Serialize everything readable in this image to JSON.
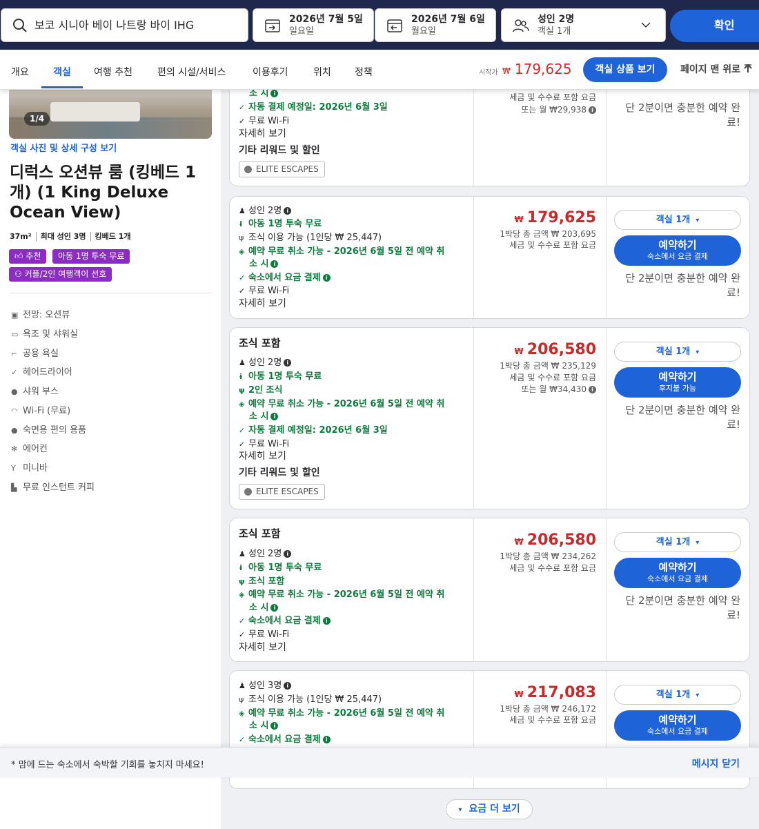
{
  "search": {
    "destination": "보코 시니아 베이 나트랑 바이 IHG",
    "checkin_date": "2026년 7월 5일",
    "checkin_day": "일요일",
    "checkout_date": "2026년 7월 6일",
    "checkout_day": "월요일",
    "guests": "성인 2명",
    "rooms": "객실 1개",
    "confirm_label": "확인"
  },
  "tabs": [
    "개요",
    "객실",
    "여행 추천",
    "편의 시설/서비스",
    "이용후기",
    "위치",
    "정책"
  ],
  "sticky": {
    "from_label": "시작가",
    "currency": "₩",
    "from_price": "179,625",
    "view_rooms": "객실 상품 보기",
    "back_to_top": "페이지 맨 위로"
  },
  "room": {
    "photo_counter": "1/4",
    "photo_link": "객실 사진 및 상세 구성 보기",
    "title": "디럭스 오션뷰 룸 (킹베드 1개) (1 King Deluxe Ocean View)",
    "specs": [
      "37m²",
      "최대 성인 3명",
      "킹베드 1개"
    ],
    "badges": [
      "추천",
      "아동 1명 투숙 무료",
      "커플/2인 여행객이 선호"
    ],
    "amenities": [
      "전망: 오션뷰",
      "욕조 및 샤워실",
      "공용 욕실",
      "헤어드라이어",
      "샤워 부스",
      "Wi-Fi (무료)",
      "숙면용 편의 용품",
      "에어컨",
      "미니바",
      "무료 인스턴트 커피"
    ]
  },
  "common": {
    "room_select": "객실 1개",
    "book": "예약하기",
    "quick_book": "단 2분이면 충분한 예약 완료!",
    "details": "자세히 보기",
    "extra_rewards": "기타 리워드 및 할인",
    "elite": "ELITE ESCAPES",
    "wifi": "무료 Wi-Fi",
    "tax_incl": "세금 및 수수료 포함 요금",
    "free_child": "아동 1명 투숙 무료",
    "free_cancel_1": "예약 무료 취소 가능 - 2026년 6월 5일 전 예약 취",
    "free_cancel_2": "소 시",
    "auto_pay": "자동 결제 예정일: 2026년 6월 3일",
    "pay_at_hotel": "숙소에서 요금 결제",
    "pay_later": "후지불 가능",
    "breakfast_title": "조식 포함"
  },
  "offers": [
    {
      "cancel_tail": "소 시",
      "monthly": "또는 월 ₩29,938",
      "total_line": "1박당 총 금액 ₩ 203,695"
    },
    {
      "adults": "성인 2명",
      "breakfast": "조식 이용 가능 (1인당 ₩ 25,447)",
      "price": "179,625",
      "total": "1박당 총 금액 ₩ 203,695",
      "book_sub": "숙소에서 요금 결제"
    },
    {
      "adults": "성인 2명",
      "breakfast": "2인 조식",
      "price": "206,580",
      "total": "1박당 총 금액 ₩ 235,129",
      "monthly": "또는 월 ₩34,430",
      "book_sub": "후지불 가능"
    },
    {
      "adults": "성인 2명",
      "breakfast": "조식 포함",
      "price": "206,580",
      "total": "1박당 총 금액 ₩ 234,262",
      "book_sub": "숙소에서 요금 결제"
    },
    {
      "adults": "성인 3명",
      "breakfast": "조식 이용 가능 (1인당 ₩ 25,447)",
      "price": "217,083",
      "total": "1박당 총 금액 ₩ 246,172",
      "book_sub": "숙소에서 요금 결제"
    }
  ],
  "banner": {
    "message": "* 맘에 드는 숙소에서 숙박할 기회를 놓치지 마세요!",
    "close": "메시지 닫기"
  },
  "more_rates": "요금 더 보기",
  "colors": {
    "brand_blue": "#1e64d8",
    "header_navy": "#20274d",
    "price_red": "#c72a2a",
    "green": "#0f7a3d",
    "badge_purple": "#8b2cc2"
  }
}
